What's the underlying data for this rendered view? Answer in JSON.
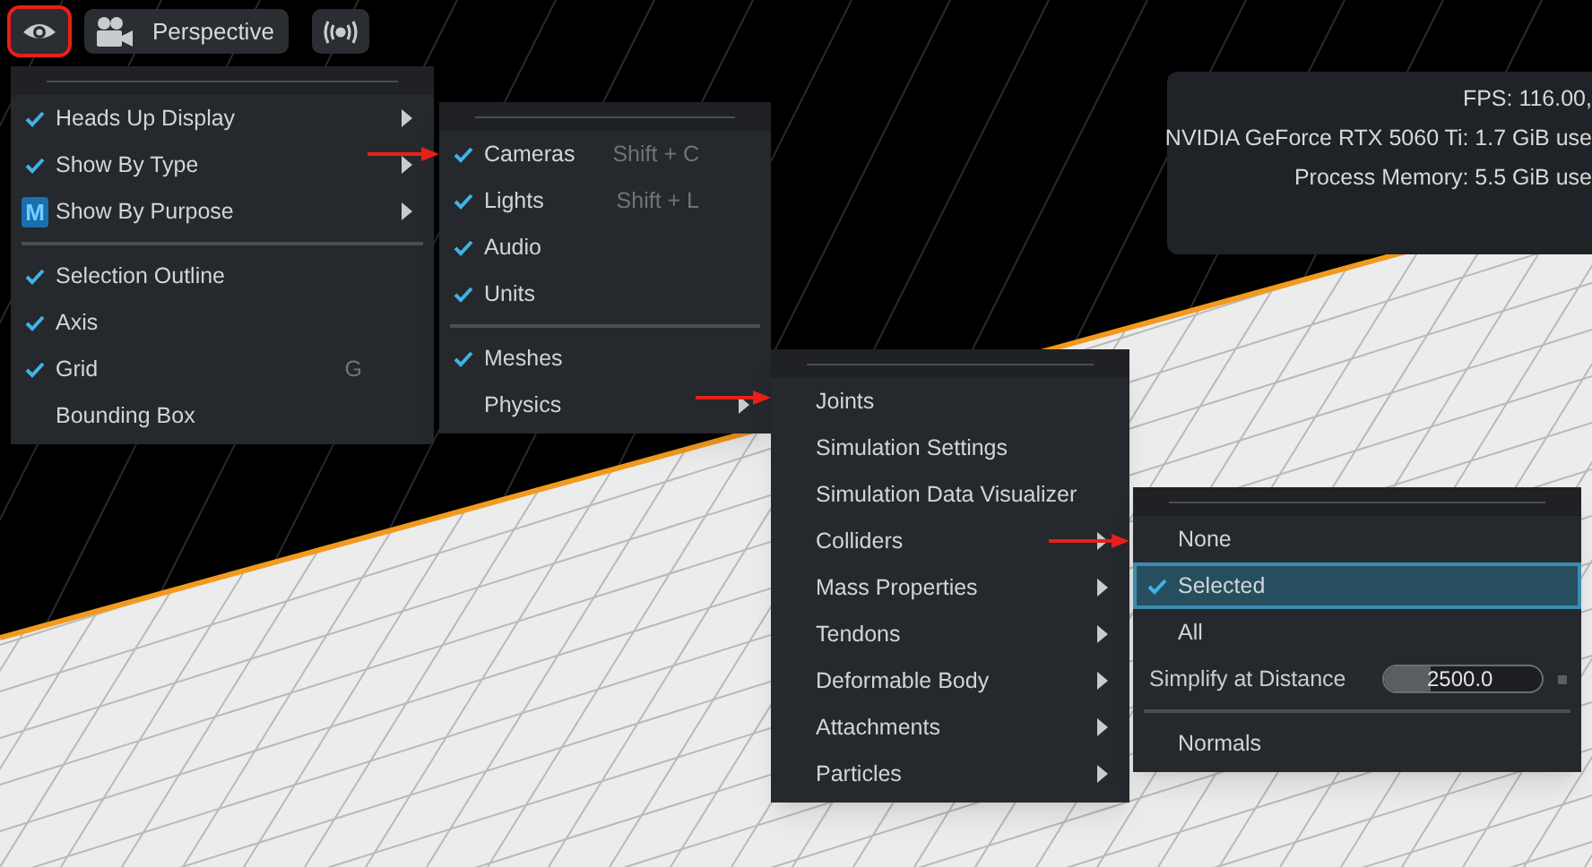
{
  "toolbar": {
    "buttons": [
      {
        "kind": "eye",
        "selected": true
      },
      {
        "kind": "camera",
        "label": "Perspective",
        "selected": false
      },
      {
        "kind": "broadcast",
        "selected": false
      }
    ]
  },
  "hud": {
    "lines": [
      "FPS: 116.00,",
      "NVIDIA GeForce RTX 5060 Ti: 1.7 GiB use",
      "Process Memory: 5.5 GiB use"
    ]
  },
  "menus": [
    {
      "items": [
        {
          "kind": "item",
          "label": "Heads Up Display",
          "checked": true,
          "submenu": true
        },
        {
          "kind": "item",
          "label": "Show By Type",
          "checked": true,
          "submenu": true
        },
        {
          "kind": "item",
          "label": "Show By Purpose",
          "submenu": true,
          "badge": "M"
        },
        {
          "kind": "separator"
        },
        {
          "kind": "item",
          "label": "Selection Outline",
          "checked": true,
          "submenu": false
        },
        {
          "kind": "item",
          "label": "Axis",
          "checked": true,
          "submenu": false
        },
        {
          "kind": "item",
          "label": "Grid",
          "checked": true,
          "submenu": false,
          "shortcut": "G"
        },
        {
          "kind": "item",
          "label": "Bounding Box",
          "checked": false,
          "submenu": false
        }
      ]
    },
    {
      "items": [
        {
          "kind": "item",
          "label": "Cameras",
          "checked": true,
          "submenu": false,
          "shortcut": "Shift + C"
        },
        {
          "kind": "item",
          "label": "Lights",
          "checked": true,
          "submenu": false,
          "shortcut": "Shift + L"
        },
        {
          "kind": "item",
          "label": "Audio",
          "checked": true,
          "submenu": false
        },
        {
          "kind": "item",
          "label": "Units",
          "checked": true,
          "submenu": false
        },
        {
          "kind": "separator"
        },
        {
          "kind": "item",
          "label": "Meshes",
          "checked": true,
          "submenu": false
        },
        {
          "kind": "item",
          "label": "Physics",
          "checked": false,
          "submenu": true
        }
      ]
    },
    {
      "items": [
        {
          "kind": "item",
          "label": "Joints",
          "checked": false,
          "submenu": false
        },
        {
          "kind": "item",
          "label": "Simulation Settings",
          "checked": false,
          "submenu": false
        },
        {
          "kind": "item",
          "label": "Simulation Data Visualizer",
          "checked": false,
          "submenu": false
        },
        {
          "kind": "item",
          "label": "Colliders",
          "checked": false,
          "submenu": true
        },
        {
          "kind": "item",
          "label": "Mass Properties",
          "checked": false,
          "submenu": true
        },
        {
          "kind": "item",
          "label": "Tendons",
          "checked": false,
          "submenu": true
        },
        {
          "kind": "item",
          "label": "Deformable Body",
          "checked": false,
          "submenu": true
        },
        {
          "kind": "item",
          "label": "Attachments",
          "checked": false,
          "submenu": true
        },
        {
          "kind": "item",
          "label": "Particles",
          "checked": false,
          "submenu": true
        }
      ]
    },
    {
      "items": [
        {
          "kind": "item",
          "label": "None",
          "checked": false,
          "submenu": false,
          "selected": false
        },
        {
          "kind": "item",
          "label": "Selected",
          "checked": true,
          "submenu": false,
          "selected": true
        },
        {
          "kind": "item",
          "label": "All",
          "checked": false,
          "submenu": false,
          "selected": false
        },
        {
          "kind": "slider",
          "label": "Simplify at Distance",
          "value": "2500.0",
          "level": 0.3
        },
        {
          "kind": "separator"
        },
        {
          "kind": "item",
          "label": "Normals",
          "checked": false,
          "submenu": false,
          "selected": false
        }
      ]
    }
  ]
}
